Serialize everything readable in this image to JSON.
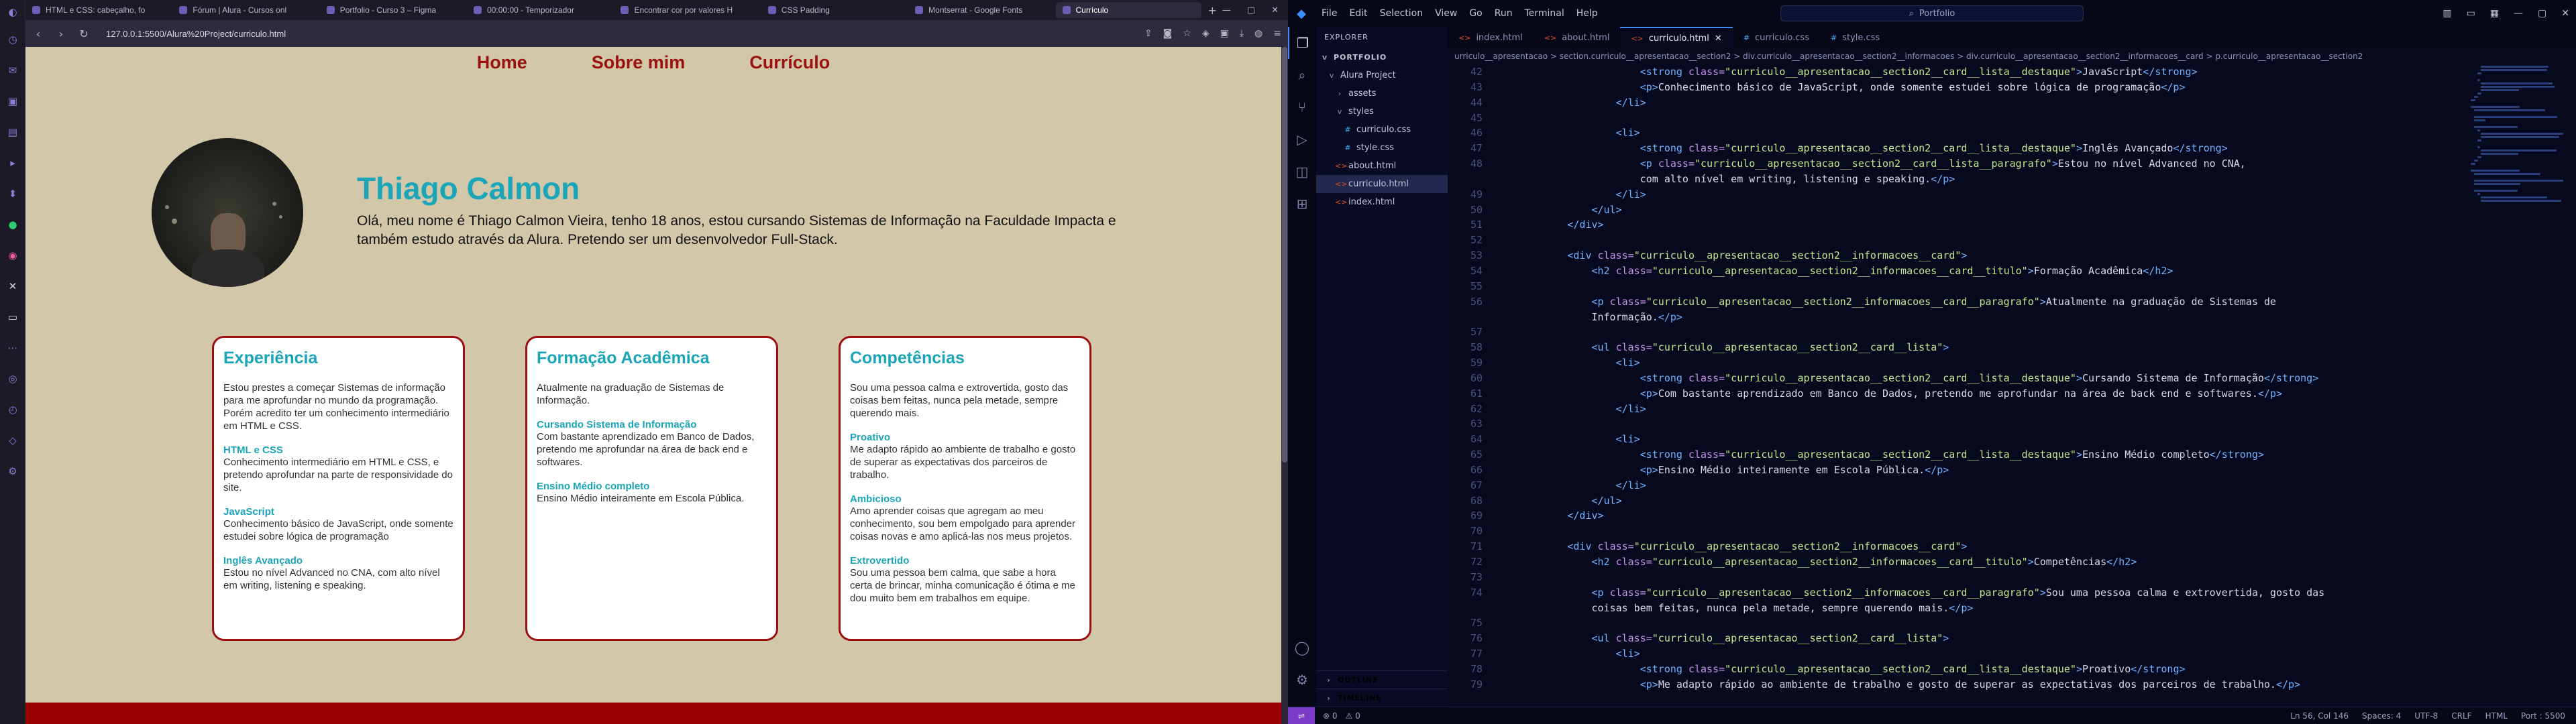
{
  "browser": {
    "tabs": [
      {
        "title": "HTML e CSS: cabeçalho, fo"
      },
      {
        "title": "Fórum | Alura - Cursos onl"
      },
      {
        "title": "Portfolio - Curso 3 – Figma"
      },
      {
        "title": "00:00:00 - Temporizador"
      },
      {
        "title": "Encontrar cor por valores H"
      },
      {
        "title": "CSS Padding"
      },
      {
        "title": "Montserrat - Google Fonts"
      },
      {
        "title": "Currículo"
      }
    ],
    "url": "127.0.0.1:5500/Alura%20Project/curriculo.html"
  },
  "site": {
    "nav": [
      "Home",
      "Sobre mim",
      "Currículo"
    ],
    "name": "Thiago Calmon",
    "intro": "Olá, meu nome é Thiago Calmon Vieira, tenho 18 anos, estou cursando Sistemas de Informação na Faculdade Impacta e também estudo através da Alura. Pretendo ser um desenvolvedor Full-Stack.",
    "cards": [
      {
        "title": "Experiência",
        "paragraph": "Estou prestes a começar Sistemas de informação para me aprofundar no mundo da programação. Porém acredito ter um conhecimento intermediário em HTML e CSS.",
        "items": [
          {
            "label": "HTML e CSS",
            "text": "Conhecimento intermediário em HTML e CSS, e pretendo aprofundar na parte de responsividade do site."
          },
          {
            "label": "JavaScript",
            "text": "Conhecimento básico de JavaScript, onde somente estudei sobre lógica de programação"
          },
          {
            "label": "Inglês Avançado",
            "text": "Estou no nível Advanced no CNA, com alto nível em writing, listening e speaking."
          }
        ]
      },
      {
        "title": "Formação Acadêmica",
        "paragraph": "Atualmente na graduação de Sistemas de Informação.",
        "items": [
          {
            "label": "Cursando Sistema de Informação",
            "text": "Com bastante aprendizado em Banco de Dados, pretendo me aprofundar na área de back end e softwares."
          },
          {
            "label": "Ensino Médio completo",
            "text": "Ensino Médio inteiramente em Escola Pública."
          }
        ]
      },
      {
        "title": "Competências",
        "paragraph": "Sou uma pessoa calma e extrovertida, gosto das coisas bem feitas, nunca pela metade, sempre querendo mais.",
        "items": [
          {
            "label": "Proativo",
            "text": "Me adapto rápido ao ambiente de trabalho e gosto de superar as expectativas dos parceiros de trabalho."
          },
          {
            "label": "Ambicioso",
            "text": "Amo aprender coisas que agregam ao meu conhecimento, sou bem empolgado para aprender coisas novas e amo aplicá-las nos meus projetos."
          },
          {
            "label": "Extrovertido",
            "text": "Sou uma pessoa bem calma, que sabe a hora certa de brincar, minha comunicação é ótima e me dou muito bem em trabalhos em equipe."
          }
        ]
      }
    ]
  },
  "vscode": {
    "menu": [
      "File",
      "Edit",
      "Selection",
      "View",
      "Go",
      "Run",
      "Terminal",
      "Help"
    ],
    "search": "Portfolio",
    "explorer_label": "EXPLORER",
    "root": "PORTFOLIO",
    "tree": [
      {
        "label": "Alura Project",
        "depth": 1,
        "icon": "v",
        "kind": "folder"
      },
      {
        "label": "assets",
        "depth": 2,
        "icon": ">",
        "kind": "folder"
      },
      {
        "label": "styles",
        "depth": 2,
        "icon": "v",
        "kind": "folder"
      },
      {
        "label": "curriculo.css",
        "depth": 3,
        "icon": "#",
        "kind": "css"
      },
      {
        "label": "style.css",
        "depth": 3,
        "icon": "#",
        "kind": "css"
      },
      {
        "label": "about.html",
        "depth": 2,
        "icon": "<>",
        "kind": "html"
      },
      {
        "label": "curriculo.html",
        "depth": 2,
        "icon": "<>",
        "kind": "html",
        "selected": true
      },
      {
        "label": "index.html",
        "depth": 2,
        "icon": "<>",
        "kind": "html"
      }
    ],
    "outline": "OUTLINE",
    "timeline": "TIMELINE",
    "tabs": [
      {
        "label": "index.html",
        "kind": "html"
      },
      {
        "label": "about.html",
        "kind": "html"
      },
      {
        "label": "curriculo.html",
        "kind": "html",
        "active": true
      },
      {
        "label": "curriculo.css",
        "kind": "css"
      },
      {
        "label": "style.css",
        "kind": "css"
      }
    ],
    "breadcrumb": "urriculo__apresentacao  >  section.curriculo__apresentacao__section2  >  div.curriculo__apresentacao__section2__informacoes  >  div.curriculo__apresentacao__section2__informacoes__card  >  p.curriculo__apresentacao__section2",
    "code": [
      {
        "n": "42",
        "i": 6,
        "parts": [
          [
            "t",
            "<strong "
          ],
          [
            "a",
            "class="
          ],
          [
            "s",
            "\"curriculo__apresentacao__section2__card__lista__destaque\""
          ],
          [
            "t",
            ">"
          ],
          [
            "x",
            "JavaScript"
          ],
          [
            "t",
            "</strong>"
          ]
        ]
      },
      {
        "n": "43",
        "i": 6,
        "parts": [
          [
            "t",
            "<p>"
          ],
          [
            "x",
            "Conhecimento básico de JavaScript, onde somente estudei sobre lógica de programação"
          ],
          [
            "t",
            "</p>"
          ]
        ]
      },
      {
        "n": "44",
        "i": 5,
        "parts": [
          [
            "t",
            "</li>"
          ]
        ]
      },
      {
        "n": "45",
        "i": 0,
        "parts": []
      },
      {
        "n": "46",
        "i": 5,
        "parts": [
          [
            "t",
            "<li>"
          ]
        ]
      },
      {
        "n": "47",
        "i": 6,
        "parts": [
          [
            "t",
            "<strong "
          ],
          [
            "a",
            "class="
          ],
          [
            "s",
            "\"curriculo__apresentacao__section2__card__lista__destaque\""
          ],
          [
            "t",
            ">"
          ],
          [
            "x",
            "Inglês Avançado"
          ],
          [
            "t",
            "</strong>"
          ]
        ]
      },
      {
        "n": "48",
        "i": 6,
        "parts": [
          [
            "t",
            "<p "
          ],
          [
            "a",
            "class="
          ],
          [
            "s",
            "\"curriculo__apresentacao__section2__card__lista__paragrafo\""
          ],
          [
            "t",
            ">"
          ],
          [
            "x",
            "Estou no nível Advanced no CNA,"
          ]
        ]
      },
      {
        "n": "",
        "i": 6,
        "parts": [
          [
            "x",
            "com alto nível em writing, listening e speaking."
          ],
          [
            "t",
            "</p>"
          ]
        ]
      },
      {
        "n": "49",
        "i": 5,
        "parts": [
          [
            "t",
            "</li>"
          ]
        ]
      },
      {
        "n": "50",
        "i": 4,
        "parts": [
          [
            "t",
            "</ul>"
          ]
        ]
      },
      {
        "n": "51",
        "i": 3,
        "parts": [
          [
            "t",
            "</div>"
          ]
        ]
      },
      {
        "n": "52",
        "i": 0,
        "parts": []
      },
      {
        "n": "53",
        "i": 3,
        "parts": [
          [
            "t",
            "<div "
          ],
          [
            "a",
            "class="
          ],
          [
            "s",
            "\"curriculo__apresentacao__section2__informacoes__card\""
          ],
          [
            "t",
            ">"
          ]
        ]
      },
      {
        "n": "54",
        "i": 4,
        "parts": [
          [
            "t",
            "<h2 "
          ],
          [
            "a",
            "class="
          ],
          [
            "s",
            "\"curriculo__apresentacao__section2__informacoes__card__titulo\""
          ],
          [
            "t",
            ">"
          ],
          [
            "x",
            "Formação Acadêmica"
          ],
          [
            "t",
            "</h2>"
          ]
        ]
      },
      {
        "n": "55",
        "i": 0,
        "parts": []
      },
      {
        "n": "56",
        "i": 4,
        "parts": [
          [
            "t",
            "<p "
          ],
          [
            "a",
            "class="
          ],
          [
            "s",
            "\"curriculo__apresentacao__section2__informacoes__card__paragrafo\""
          ],
          [
            "t",
            ">"
          ],
          [
            "x",
            "Atualmente na graduação de Sistemas de"
          ]
        ]
      },
      {
        "n": "",
        "i": 4,
        "parts": [
          [
            "x",
            "Informação."
          ],
          [
            "t",
            "</p>"
          ]
        ]
      },
      {
        "n": "57",
        "i": 0,
        "parts": []
      },
      {
        "n": "58",
        "i": 4,
        "parts": [
          [
            "t",
            "<ul "
          ],
          [
            "a",
            "class="
          ],
          [
            "s",
            "\"curriculo__apresentacao__section2__card__lista\""
          ],
          [
            "t",
            ">"
          ]
        ]
      },
      {
        "n": "59",
        "i": 5,
        "parts": [
          [
            "t",
            "<li>"
          ]
        ]
      },
      {
        "n": "60",
        "i": 6,
        "parts": [
          [
            "t",
            "<strong "
          ],
          [
            "a",
            "class="
          ],
          [
            "s",
            "\"curriculo__apresentacao__section2__card__lista__destaque\""
          ],
          [
            "t",
            ">"
          ],
          [
            "x",
            "Cursando Sistema de Informação"
          ],
          [
            "t",
            "</strong>"
          ]
        ]
      },
      {
        "n": "61",
        "i": 6,
        "parts": [
          [
            "t",
            "<p>"
          ],
          [
            "x",
            "Com bastante aprendizado em Banco de Dados, pretendo me aprofundar na área de back end e softwares."
          ],
          [
            "t",
            "</p>"
          ]
        ]
      },
      {
        "n": "62",
        "i": 5,
        "parts": [
          [
            "t",
            "</li>"
          ]
        ]
      },
      {
        "n": "63",
        "i": 0,
        "parts": []
      },
      {
        "n": "64",
        "i": 5,
        "parts": [
          [
            "t",
            "<li>"
          ]
        ]
      },
      {
        "n": "65",
        "i": 6,
        "parts": [
          [
            "t",
            "<strong "
          ],
          [
            "a",
            "class="
          ],
          [
            "s",
            "\"curriculo__apresentacao__section2__card__lista__destaque\""
          ],
          [
            "t",
            ">"
          ],
          [
            "x",
            "Ensino Médio completo"
          ],
          [
            "t",
            "</strong>"
          ]
        ]
      },
      {
        "n": "66",
        "i": 6,
        "parts": [
          [
            "t",
            "<p>"
          ],
          [
            "x",
            "Ensino Médio inteiramente em Escola Pública."
          ],
          [
            "t",
            "</p>"
          ]
        ]
      },
      {
        "n": "67",
        "i": 5,
        "parts": [
          [
            "t",
            "</li>"
          ]
        ]
      },
      {
        "n": "68",
        "i": 4,
        "parts": [
          [
            "t",
            "</ul>"
          ]
        ]
      },
      {
        "n": "69",
        "i": 3,
        "parts": [
          [
            "t",
            "</div>"
          ]
        ]
      },
      {
        "n": "70",
        "i": 0,
        "parts": []
      },
      {
        "n": "71",
        "i": 3,
        "parts": [
          [
            "t",
            "<div "
          ],
          [
            "a",
            "class="
          ],
          [
            "s",
            "\"curriculo__apresentacao__section2__informacoes__card\""
          ],
          [
            "t",
            ">"
          ]
        ]
      },
      {
        "n": "72",
        "i": 4,
        "parts": [
          [
            "t",
            "<h2 "
          ],
          [
            "a",
            "class="
          ],
          [
            "s",
            "\"curriculo__apresentacao__section2__informacoes__card__titulo\""
          ],
          [
            "t",
            ">"
          ],
          [
            "x",
            "Competências"
          ],
          [
            "t",
            "</h2>"
          ]
        ]
      },
      {
        "n": "73",
        "i": 0,
        "parts": []
      },
      {
        "n": "74",
        "i": 4,
        "parts": [
          [
            "t",
            "<p "
          ],
          [
            "a",
            "class="
          ],
          [
            "s",
            "\"curriculo__apresentacao__section2__informacoes__card__paragrafo\""
          ],
          [
            "t",
            ">"
          ],
          [
            "x",
            "Sou uma pessoa calma e extrovertida, gosto das"
          ]
        ]
      },
      {
        "n": "",
        "i": 4,
        "parts": [
          [
            "x",
            "coisas bem feitas, nunca pela metade, sempre querendo mais."
          ],
          [
            "t",
            "</p>"
          ]
        ]
      },
      {
        "n": "75",
        "i": 0,
        "parts": []
      },
      {
        "n": "76",
        "i": 4,
        "parts": [
          [
            "t",
            "<ul "
          ],
          [
            "a",
            "class="
          ],
          [
            "s",
            "\"curriculo__apresentacao__section2__card__lista\""
          ],
          [
            "t",
            ">"
          ]
        ]
      },
      {
        "n": "77",
        "i": 5,
        "parts": [
          [
            "t",
            "<li>"
          ]
        ]
      },
      {
        "n": "78",
        "i": 6,
        "parts": [
          [
            "t",
            "<strong "
          ],
          [
            "a",
            "class="
          ],
          [
            "s",
            "\"curriculo__apresentacao__section2__card__lista__destaque\""
          ],
          [
            "t",
            ">"
          ],
          [
            "x",
            "Proativo"
          ],
          [
            "t",
            "</strong>"
          ]
        ]
      },
      {
        "n": "79",
        "i": 6,
        "parts": [
          [
            "t",
            "<p>"
          ],
          [
            "x",
            "Me adapto rápido ao ambiente de trabalho e gosto de superar as expectativas dos parceiros de trabalho."
          ],
          [
            "t",
            "</p>"
          ]
        ]
      }
    ],
    "status_left": [
      "⊗ 0",
      "⚠ 0"
    ],
    "status_right": [
      "Ln 56, Col 146",
      "Spaces: 4",
      "UTF-8",
      "CRLF",
      "HTML",
      "Port : 5500"
    ]
  },
  "colors": {
    "page_bg": "#d3c7a9",
    "accent_red": "#9b1010",
    "accent_teal": "#1aa5b8",
    "editor_bg": "#07091f"
  }
}
